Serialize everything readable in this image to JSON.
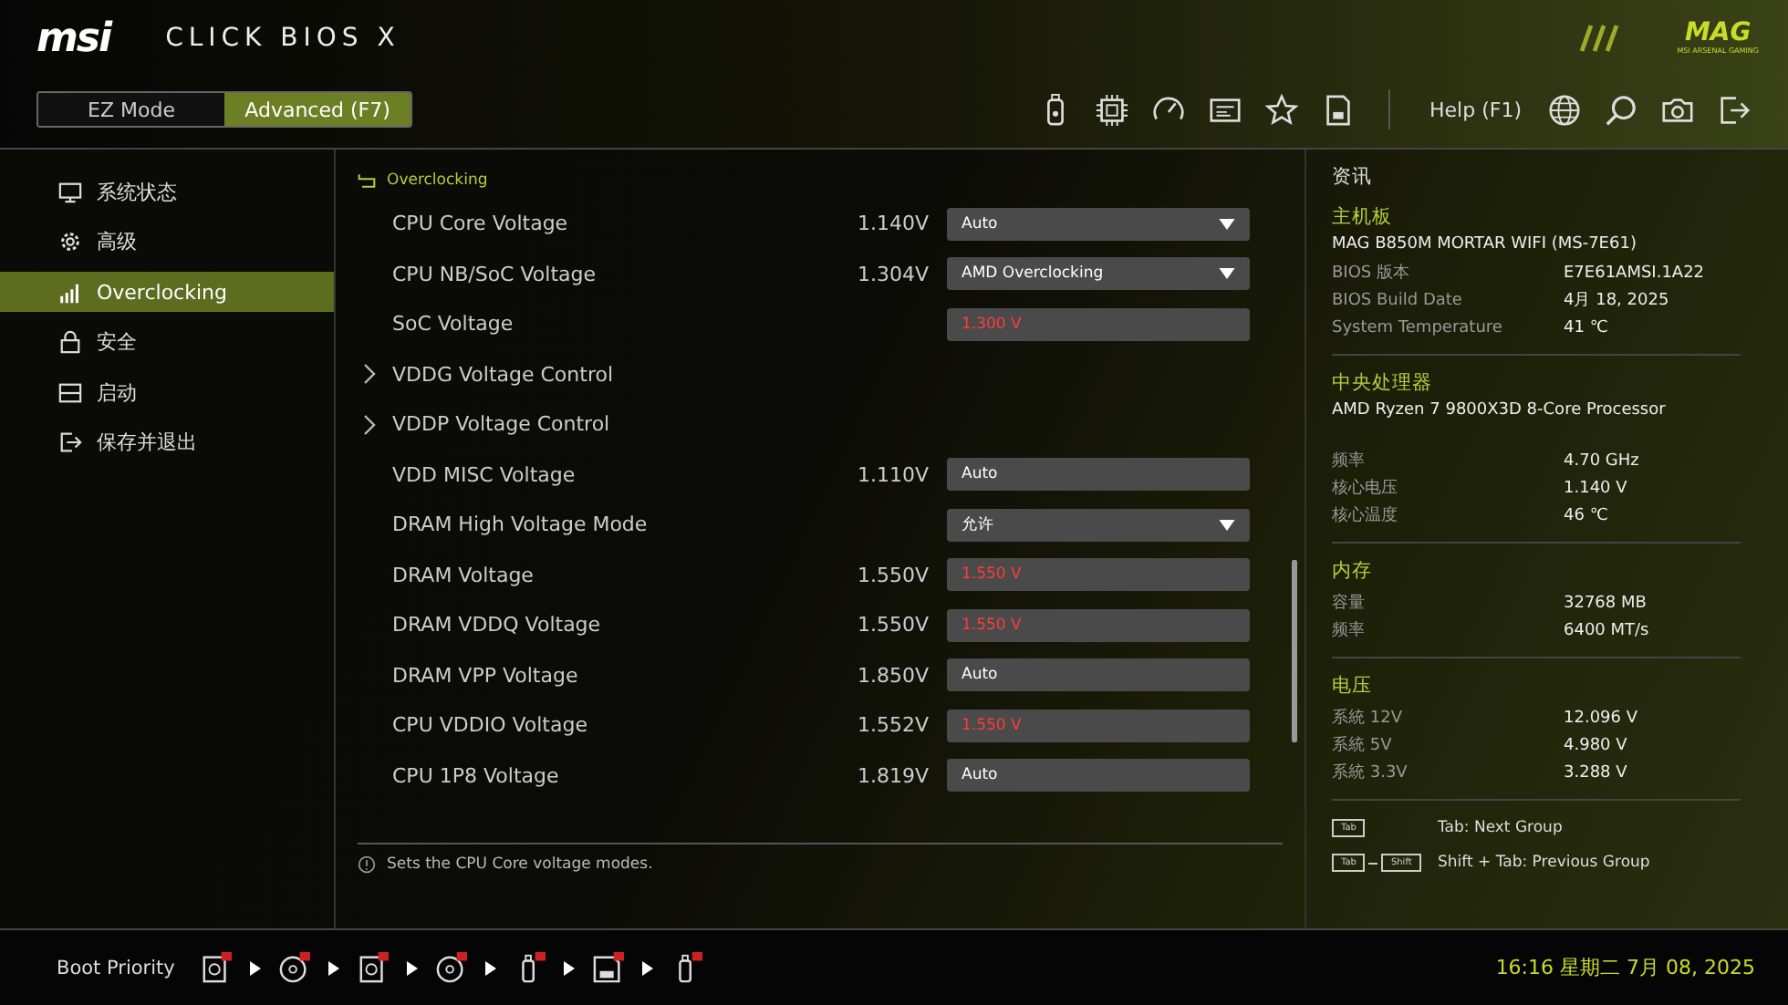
{
  "header": {
    "brand": "msi",
    "product": "CLICK BIOS X",
    "badge": "MAG",
    "badge_sub": "MSI ARSENAL GAMING",
    "modes": [
      {
        "label": "EZ Mode",
        "selected": false
      },
      {
        "label": "Advanced (F7)",
        "selected": true
      }
    ],
    "help": "Help (F1)"
  },
  "sidebar": {
    "items": [
      {
        "label": "系统状态",
        "selected": false
      },
      {
        "label": "高级",
        "selected": false
      },
      {
        "label": "Overclocking",
        "selected": true
      },
      {
        "label": "安全",
        "selected": false
      },
      {
        "label": "启动",
        "selected": false
      },
      {
        "label": "保存并退出",
        "selected": false
      }
    ]
  },
  "settings": {
    "breadcrumb": "Overclocking",
    "rows": [
      {
        "kind": "value",
        "label": "CPU Core Voltage",
        "reading": "1.140V",
        "value": "Auto",
        "dropdown": true,
        "warn": false
      },
      {
        "kind": "value",
        "label": "CPU NB/SoC Voltage",
        "reading": "1.304V",
        "value": "AMD Overclocking",
        "dropdown": true,
        "warn": false
      },
      {
        "kind": "value",
        "label": "SoC Voltage",
        "value": "1.300 V",
        "dropdown": false,
        "warn": true
      },
      {
        "kind": "submenu",
        "label": "VDDG Voltage Control"
      },
      {
        "kind": "submenu",
        "label": "VDDP Voltage Control"
      },
      {
        "kind": "value",
        "label": "VDD MISC Voltage",
        "reading": "1.110V",
        "value": "Auto",
        "dropdown": false,
        "warn": false
      },
      {
        "kind": "value",
        "label": "DRAM High Voltage Mode",
        "value": "允许",
        "dropdown": true,
        "warn": false
      },
      {
        "kind": "value",
        "label": "DRAM Voltage",
        "reading": "1.550V",
        "value": "1.550 V",
        "dropdown": false,
        "warn": true
      },
      {
        "kind": "value",
        "label": "DRAM VDDQ Voltage",
        "reading": "1.550V",
        "value": "1.550 V",
        "dropdown": false,
        "warn": true
      },
      {
        "kind": "value",
        "label": "DRAM VPP Voltage",
        "reading": "1.850V",
        "value": "Auto",
        "dropdown": false,
        "warn": false
      },
      {
        "kind": "value",
        "label": "CPU VDDIO Voltage",
        "reading": "1.552V",
        "value": "1.550 V",
        "dropdown": false,
        "warn": true
      },
      {
        "kind": "value",
        "label": "CPU 1P8 Voltage",
        "reading": "1.819V",
        "value": "Auto",
        "dropdown": false,
        "warn": false
      }
    ],
    "help_text": "Sets the CPU Core voltage modes."
  },
  "info": {
    "title": "资讯",
    "groups": [
      {
        "title": "主机板",
        "headline": "MAG B850M MORTAR WIFI (MS-7E61)",
        "rows": [
          [
            "BIOS 版本",
            "E7E61AMSI.1A22"
          ],
          [
            "BIOS Build Date",
            "4月 18, 2025"
          ],
          [
            "System Temperature",
            "41 ℃"
          ]
        ]
      },
      {
        "title": "中央处理器",
        "headline": "AMD Ryzen 7 9800X3D 8-Core Processor",
        "rows": [
          [
            "频率",
            "4.70 GHz"
          ],
          [
            "核心电压",
            "1.140 V"
          ],
          [
            "核心温度",
            "46 ℃"
          ]
        ]
      },
      {
        "title": "内存",
        "rows": [
          [
            "容量",
            "32768 MB"
          ],
          [
            "频率",
            "6400 MT/s"
          ]
        ]
      },
      {
        "title": "电压",
        "rows": [
          [
            "系統 12V",
            "12.096 V"
          ],
          [
            "系統 5V",
            "4.980 V"
          ],
          [
            "系統 3.3V",
            "3.288 V"
          ]
        ]
      }
    ],
    "hints": [
      {
        "keys": [
          "Tab"
        ],
        "text": "Tab: Next Group"
      },
      {
        "keys": [
          "Tab",
          "Shift"
        ],
        "text": "Shift + Tab: Previous Group"
      }
    ]
  },
  "footer": {
    "boot_label": "Boot Priority",
    "clock": "16:16  星期二  7月 08, 2025"
  }
}
